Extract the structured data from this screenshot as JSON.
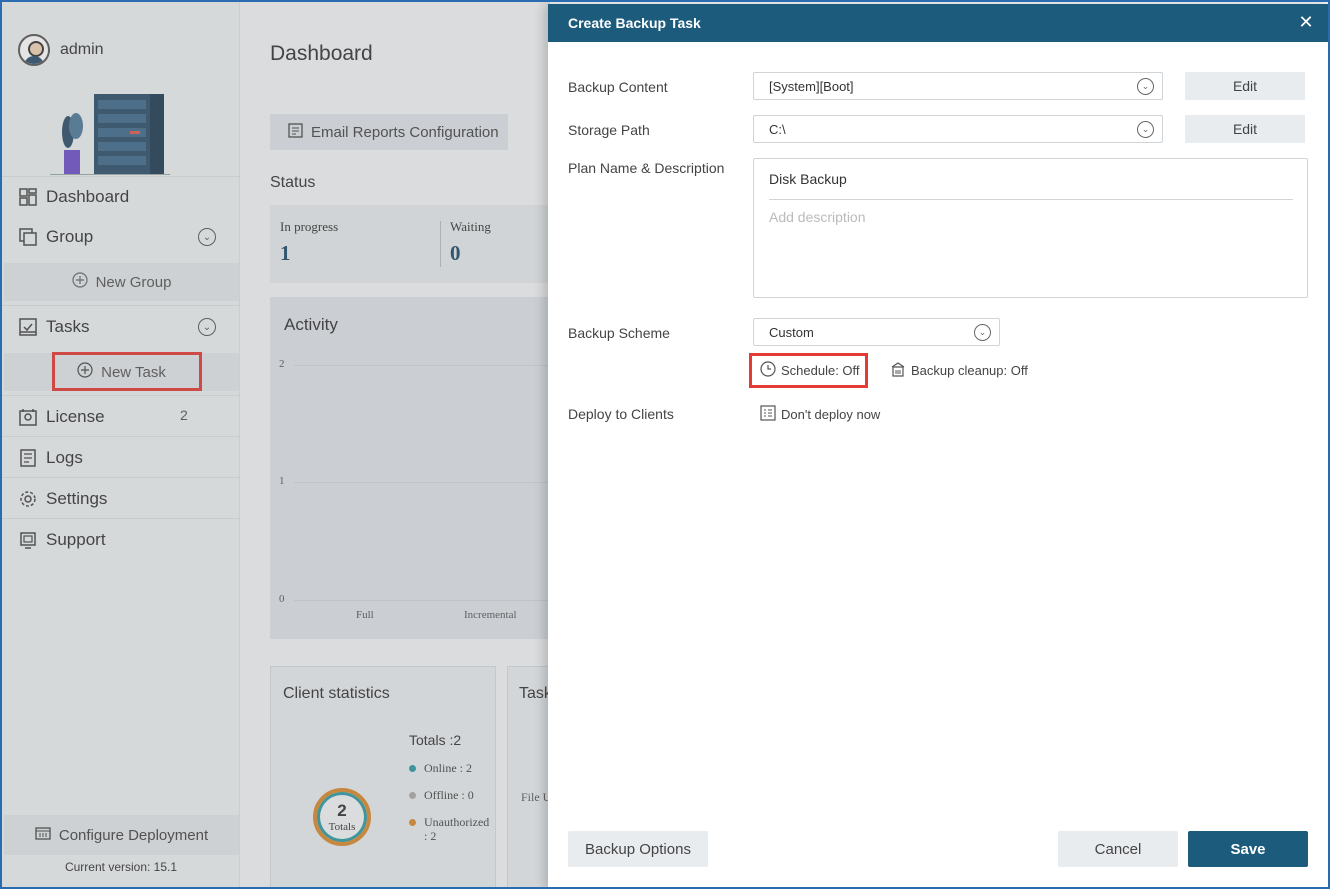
{
  "sidebar": {
    "user_name": "admin",
    "items": [
      {
        "label": "Dashboard",
        "icon": "dashboard-icon"
      },
      {
        "label": "Group",
        "icon": "group-icon"
      },
      {
        "label": "Tasks",
        "icon": "tasks-icon"
      },
      {
        "label": "License",
        "icon": "license-icon",
        "count": "2"
      },
      {
        "label": "Logs",
        "icon": "logs-icon"
      },
      {
        "label": "Settings",
        "icon": "gear-icon"
      },
      {
        "label": "Support",
        "icon": "support-icon"
      }
    ],
    "new_group_label": "New Group",
    "new_task_label": "New Task",
    "configure_label": "Configure Deployment",
    "version": "Current version: 15.1"
  },
  "main": {
    "title": "Dashboard",
    "email_reports_label": "Email Reports Configuration",
    "status_title": "Status",
    "status": [
      {
        "label": "In progress",
        "value": "1"
      },
      {
        "label": "Waiting",
        "value": "0"
      }
    ],
    "activity_title": "Activity",
    "activity_y_ticks": [
      "2",
      "1",
      "0"
    ],
    "activity_x_labels": [
      "Full",
      "Incremental"
    ],
    "client_stats_title": "Client statistics",
    "tasks_card_title": "Task",
    "tasks_card_text": "File U",
    "donut_value": "2",
    "donut_label": "Totals",
    "totals_label": "Totals :2",
    "legend": [
      {
        "label": "Online : 2",
        "color": "#2c9aa3"
      },
      {
        "label": "Offline : 0",
        "color": "#aaaaaa"
      },
      {
        "label": "Unauthorized : 2",
        "color": "#d8892b"
      }
    ]
  },
  "dialog": {
    "title": "Create Backup Task",
    "backup_content_label": "Backup Content",
    "backup_content_value": "[System][Boot]",
    "storage_path_label": "Storage Path",
    "storage_path_value": "C:\\",
    "edit_label": "Edit",
    "plan_label": "Plan Name & Description",
    "plan_name": "Disk Backup",
    "plan_desc_placeholder": "Add description",
    "scheme_label": "Backup Scheme",
    "scheme_value": "Custom",
    "schedule_label": "Schedule: Off",
    "cleanup_label": "Backup cleanup: Off",
    "deploy_label": "Deploy to Clients",
    "deploy_value": "Don't deploy now",
    "backup_options_label": "Backup Options",
    "cancel_label": "Cancel",
    "save_label": "Save"
  },
  "colors": {
    "header": "#1c5b7c",
    "save": "#1c5b7c",
    "highlight": "#e53935"
  }
}
